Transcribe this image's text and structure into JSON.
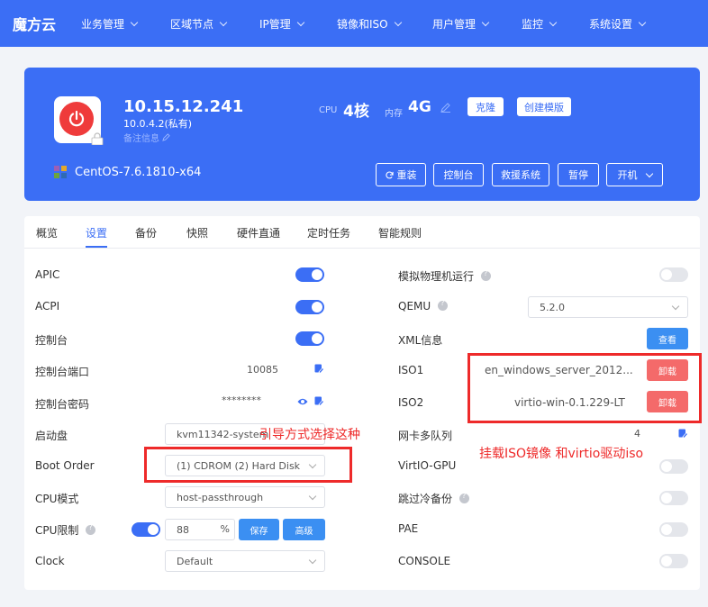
{
  "nav": {
    "brand": "魔方云",
    "items": [
      {
        "label": "业务管理",
        "has_dropdown": true
      },
      {
        "label": "区域节点",
        "has_dropdown": true
      },
      {
        "label": "IP管理",
        "has_dropdown": true
      },
      {
        "label": "镜像和ISO",
        "has_dropdown": true
      },
      {
        "label": "用户管理",
        "has_dropdown": true
      },
      {
        "label": "监控",
        "has_dropdown": true
      },
      {
        "label": "系统设置",
        "has_dropdown": true
      }
    ]
  },
  "host": {
    "ip": "10.15.12.241",
    "private_ip": "10.0.4.2(私有)",
    "remark": "备注信息",
    "cpu_label": "CPU",
    "cpu_value": "4核",
    "mem_label": "内存",
    "mem_value": "4G",
    "clone_label": "克隆",
    "template_label": "创建模版",
    "os": "CentOS-7.6.1810-x64",
    "actions": {
      "reinstall": "重装",
      "console": "控制台",
      "rescue": "救援系统",
      "pause": "暂停",
      "power": "开机"
    }
  },
  "tabs": [
    "概览",
    "设置",
    "备份",
    "快照",
    "硬件直通",
    "定时任务",
    "智能规则"
  ],
  "active_tab": "设置",
  "settings_left": {
    "apic": {
      "label": "APIC",
      "on": true
    },
    "acpi": {
      "label": "ACPI",
      "on": true
    },
    "console": {
      "label": "控制台",
      "on": true
    },
    "console_port": {
      "label": "控制台端口",
      "value": "10085"
    },
    "console_password": {
      "label": "控制台密码",
      "value": "********"
    },
    "boot_disk": {
      "label": "启动盘",
      "value": "kvm11342-system"
    },
    "boot_order": {
      "label": "Boot Order",
      "value": "(1) CDROM (2) Hard Disk"
    },
    "cpu_mode": {
      "label": "CPU模式",
      "value": "host-passthrough"
    },
    "cpu_limit": {
      "label": "CPU限制",
      "on": true,
      "value": "88",
      "unit": "%",
      "save": "保存",
      "advanced": "高级"
    },
    "clock": {
      "label": "Clock",
      "value": "Default"
    }
  },
  "settings_right": {
    "emulate_physical": {
      "label": "模拟物理机运行",
      "on": false
    },
    "qemu": {
      "label": "QEMU",
      "value": "5.2.0"
    },
    "xml": {
      "label": "XML信息",
      "button": "查看"
    },
    "iso1": {
      "label": "ISO1",
      "value": "en_windows_server_2012...",
      "button": "卸载"
    },
    "iso2": {
      "label": "ISO2",
      "value": "virtio-win-0.1.229-LT",
      "button": "卸载"
    },
    "nic_queue": {
      "label": "网卡多队列",
      "value": "4"
    },
    "virtio_gpu": {
      "label": "VirtIO-GPU",
      "on": false
    },
    "skip_cold_backup": {
      "label": "跳过冷备份",
      "on": false
    },
    "pae": {
      "label": "PAE",
      "on": false
    },
    "console2": {
      "label": "CONSOLE",
      "on": false
    }
  },
  "annotations": {
    "boot_note": "引导方式选择这种",
    "iso_note": "挂载ISO镜像 和virtio驱动iso"
  },
  "colors": {
    "primary": "#3b6ef5",
    "danger": "#f46a6a",
    "annotation": "#ee2a2a",
    "power": "#ef3b3b"
  }
}
